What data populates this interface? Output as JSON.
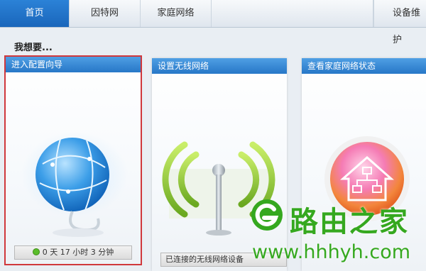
{
  "nav": {
    "tabs": [
      "首页",
      "因特网",
      "家庭网络",
      "设备维护"
    ]
  },
  "heading": "我想要...",
  "cards": [
    {
      "title": "进入配置向导",
      "status": "0 天 17 小时 3 分钟"
    },
    {
      "title": "设置无线网络",
      "status": "已连接的无线网络设备"
    },
    {
      "title": "查看家庭网络状态"
    }
  ],
  "watermark": {
    "cn": "路由之家",
    "url": "www.hhhyh.com"
  },
  "colors": {
    "nav_active": "#1f6fc4",
    "card_header": "#2f82d0",
    "highlight_border": "#d0383c",
    "watermark": "#35a81f"
  }
}
